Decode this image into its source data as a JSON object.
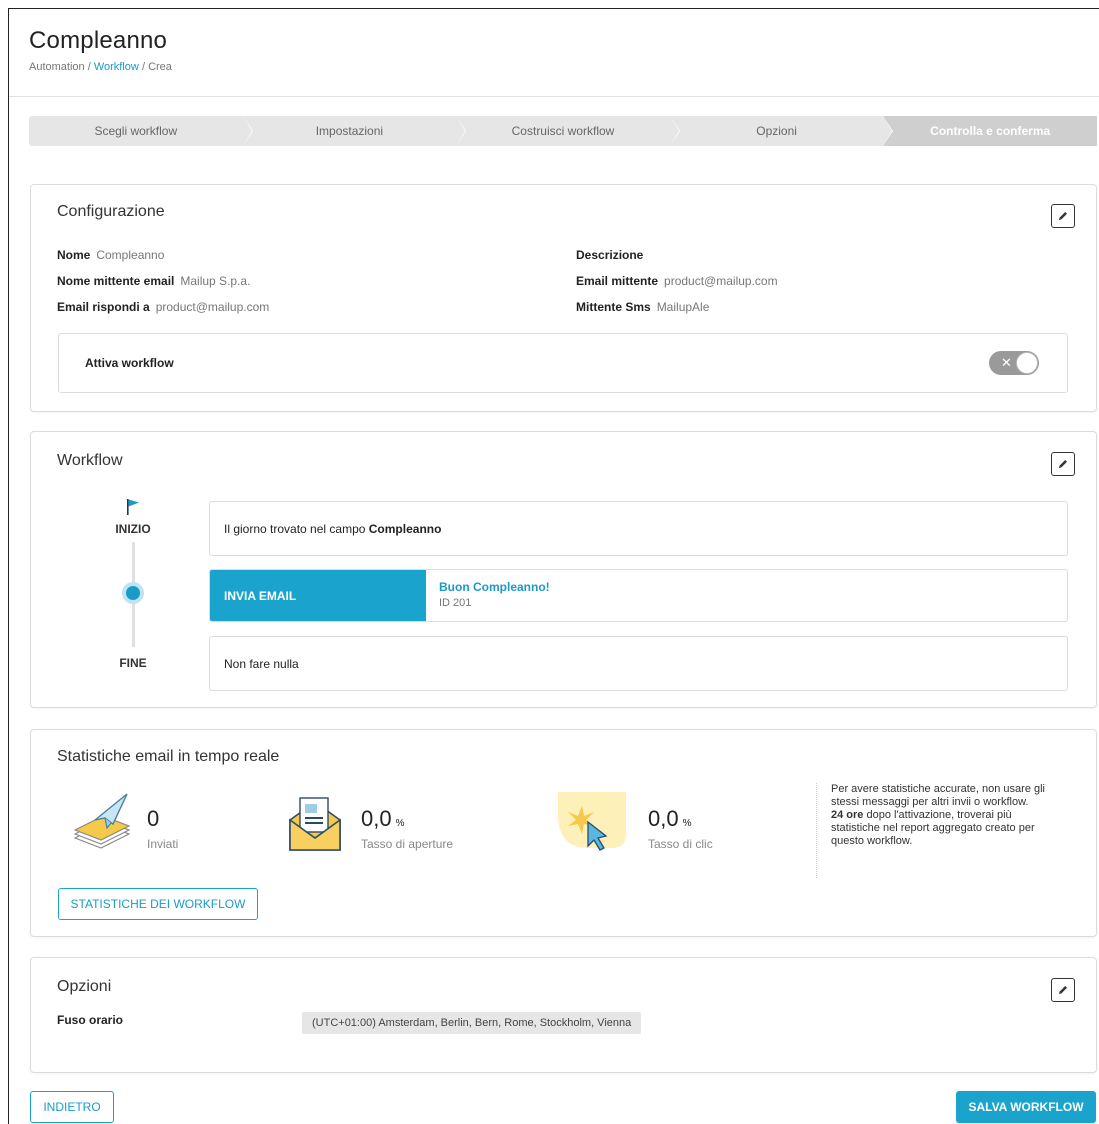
{
  "header": {
    "title": "Compleanno",
    "breadcrumb": {
      "root": "Automation",
      "sep": "/",
      "link": "Workflow",
      "current": "Crea"
    }
  },
  "stepper": [
    {
      "label": "Scegli workflow",
      "active": false
    },
    {
      "label": "Impostazioni",
      "active": false
    },
    {
      "label": "Costruisci workflow",
      "active": false
    },
    {
      "label": "Opzioni",
      "active": false
    },
    {
      "label": "Controlla e conferma",
      "active": true
    }
  ],
  "configurazione": {
    "title": "Configurazione",
    "nome_label": "Nome",
    "nome_value": "Compleanno",
    "mittente_nome_label": "Nome mittente email",
    "mittente_nome_value": "Mailup S.p.a.",
    "rispondi_label": "Email rispondi a",
    "rispondi_value": "product@mailup.com",
    "descrizione_label": "Descrizione",
    "email_mittente_label": "Email mittente",
    "email_mittente_value": "product@mailup.com",
    "sms_label": "Mittente Sms",
    "sms_value": "MailupAle",
    "attiva_label": "Attiva workflow",
    "toggle_x": "✕"
  },
  "workflow": {
    "title": "Workflow",
    "inizio_label": "INIZIO",
    "fine_label": "FINE",
    "trigger_prefix": "Il giorno trovato nel campo",
    "trigger_field": "Compleanno",
    "action_label": "INVIA EMAIL",
    "message_name": "Buon Compleanno!",
    "message_id": "ID 201",
    "end_text": "Non fare nulla"
  },
  "statistiche": {
    "title": "Statistiche email in tempo reale",
    "sent_value": "0",
    "sent_label": "Inviati",
    "open_value": "0,0",
    "open_unit": "%",
    "open_label": "Tasso di aperture",
    "click_value": "0,0",
    "click_unit": "%",
    "click_label": "Tasso di clic",
    "note_line1": "Per avere statistiche accurate, non usare gli stessi messaggi per altri invii o workflow.",
    "note_bold": "24 ore",
    "note_line2": "dopo l'attivazione, troverai più statistiche nel report aggregato creato per questo workflow.",
    "button_label": "STATISTICHE DEI WORKFLOW"
  },
  "opzioni": {
    "title": "Opzioni",
    "fuso_label": "Fuso orario",
    "fuso_value": "(UTC+01:00) Amsterdam, Berlin, Bern, Rome, Stockholm, Vienna"
  },
  "footer": {
    "back_label": "INDIETRO",
    "save_label": "SALVA WORKFLOW"
  },
  "colors": {
    "accent": "#1aa3cc",
    "link": "#1a9bc7"
  },
  "icons": {
    "edit": "pencil-icon",
    "flag": "flag-icon",
    "sent": "paper-plane-icon",
    "open": "envelope-open-icon",
    "click": "cursor-click-icon"
  }
}
